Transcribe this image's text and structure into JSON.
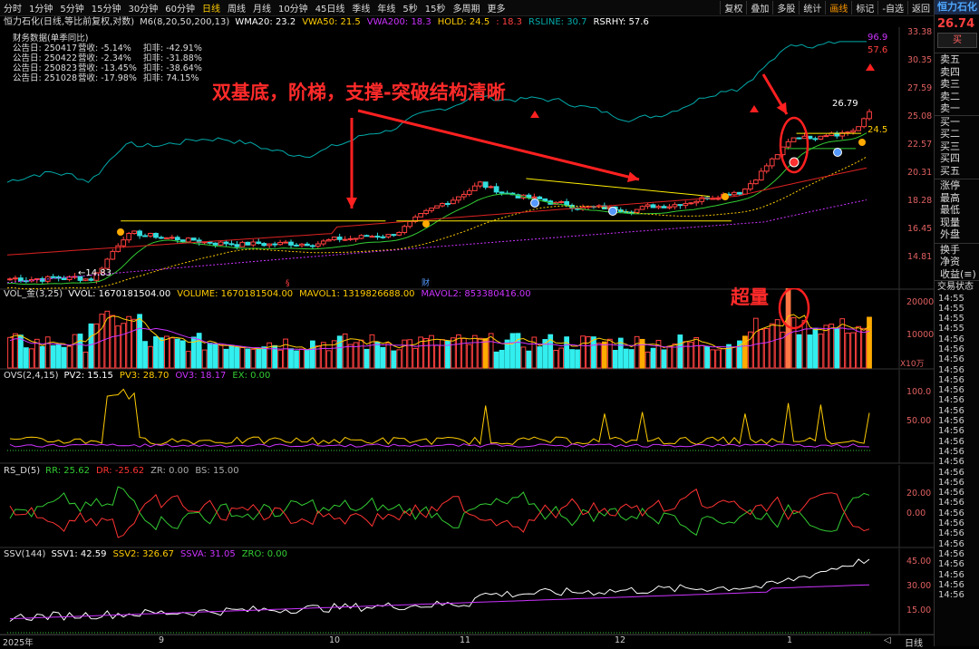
{
  "toolbar": {
    "left": [
      "分时",
      "1分钟",
      "5分钟",
      "15分钟",
      "30分钟",
      "60分钟",
      "日线",
      "周线",
      "月线",
      "10分钟",
      "45日线",
      "季线",
      "年线",
      "5秒",
      "15秒",
      "多周期",
      "更多"
    ],
    "active": "日线",
    "right": [
      "复权",
      "叠加",
      "多股",
      "统计",
      "画线",
      "标记",
      "-自选",
      "返回"
    ],
    "right_active": "画线"
  },
  "main_indicator": {
    "name": "恒力石化(日线,等比前复权,对数)",
    "ma_label": "M6(8,20,50,200,13)",
    "values": [
      {
        "label": "WMA20: 23.2",
        "color": "#ffffff"
      },
      {
        "label": "VWA50: 21.5",
        "color": "#ffcc00"
      },
      {
        "label": "VWA200: 18.3",
        "color": "#cc33ff"
      },
      {
        "label": "HOLD: 24.5",
        "color": "#ffcc00"
      },
      {
        "label": ": 18.3",
        "color": "#ff4040"
      },
      {
        "label": "RSLINE: 30.7",
        "color": "#00aaaa"
      },
      {
        "label": "RSRHY: 57.6",
        "color": "#ffffff"
      }
    ]
  },
  "financial": {
    "title": "财务数据(单季同比)",
    "rows": [
      {
        "date": "公告日: 250417",
        "rev": "营收:  -5.14%",
        "profit": "扣非:  -42.91%"
      },
      {
        "date": "公告日: 250422",
        "rev": "营收:  -2.34%",
        "profit": "扣非:  -31.88%"
      },
      {
        "date": "公告日: 250823",
        "rev": "营收: -13.45%",
        "profit": "扣非:  -38.64%"
      },
      {
        "date": "公告日: 251028",
        "rev": "营收: -17.98%",
        "profit": "扣非:  74.15%"
      }
    ]
  },
  "annotations": {
    "main_text": "双基底，阶梯，支撑-突破结构清晰",
    "volume_text": "超量",
    "price_marks": {
      "last": "26.79",
      "hold": "24.5",
      "low": "14.83",
      "top1": "96.9",
      "top2": "57.6"
    }
  },
  "price_axis": [
    "33.38",
    "30.35",
    "27.59",
    "25.08",
    "22.57",
    "20.31",
    "18.28",
    "16.45",
    "14.81"
  ],
  "volume_panel": {
    "title": "VOL_金(3,25)",
    "values": [
      {
        "label": "VVOL: 1670181504.00",
        "color": "#ffffff"
      },
      {
        "label": "VOLUME: 1670181504.00",
        "color": "#ffcc00"
      },
      {
        "label": "MAVOL1: 1319826688.00",
        "color": "#ffcc00"
      },
      {
        "label": "MAVOL2: 853380416.00",
        "color": "#cc33ff"
      }
    ],
    "axis": [
      "20000",
      "10000"
    ],
    "unit": "X10万"
  },
  "ovs_panel": {
    "title": "OVS(2,4,15)",
    "values": [
      {
        "label": "PV2: 15.15",
        "color": "#ffffff"
      },
      {
        "label": "PV3: 28.70",
        "color": "#ffcc00"
      },
      {
        "label": "OV3: 18.17",
        "color": "#cc33ff"
      },
      {
        "label": "EX: 0.00",
        "color": "#33cc33"
      }
    ],
    "axis": [
      "100.0",
      "50.00"
    ]
  },
  "rsd_panel": {
    "title": "RS_D(5)",
    "values": [
      {
        "label": "RR: 25.62",
        "color": "#33cc33"
      },
      {
        "label": "DR: -25.62",
        "color": "#ff3333"
      },
      {
        "label": "ZR: 0.00",
        "color": "#aaaaaa"
      },
      {
        "label": "BS: 15.00",
        "color": "#aaaaaa"
      }
    ],
    "axis": [
      "20.00",
      "0.00"
    ]
  },
  "ssv_panel": {
    "title": "SSV(144)",
    "values": [
      {
        "label": "SSV1: 42.59",
        "color": "#ffffff"
      },
      {
        "label": "SSV2: 326.67",
        "color": "#ffcc00"
      },
      {
        "label": "SSVA: 31.05",
        "color": "#cc33ff"
      },
      {
        "label": "ZRO: 0.00",
        "color": "#33cc33"
      }
    ],
    "axis": [
      "45.00",
      "30.00",
      "15.00"
    ]
  },
  "date_axis": [
    "2025年",
    "9",
    "10",
    "11",
    "12",
    "1"
  ],
  "date_marks": {
    "mark1": "§",
    "mark2": "财"
  },
  "bottom": {
    "period": "日线"
  },
  "right_panel": {
    "stock_name": "恒力石化",
    "price": "26.74",
    "buy_btn": "买",
    "sells": [
      "卖五",
      "卖四",
      "卖三",
      "卖二",
      "卖一"
    ],
    "buys": [
      "买一",
      "买二",
      "买三",
      "买四",
      "买五"
    ],
    "stats": [
      "涨停",
      "最高",
      "最低",
      "现量",
      "外盘"
    ],
    "stats2": [
      "换手",
      "净资",
      "收益(≡)"
    ],
    "trade_title": "交易状态",
    "times": [
      "14:55",
      "14:55",
      "14:55",
      "14:55",
      "14:56",
      "14:56",
      "14:56",
      "14:56",
      "14:56",
      "14:56",
      "14:56",
      "14:56",
      "14:56",
      "14:56",
      "14:56",
      "14:56",
      "14:56",
      "14:56",
      "14:56",
      "14:56",
      "14:56",
      "14:56",
      "14:56",
      "14:56",
      "14:56",
      "14:56",
      "14:56",
      "14:56",
      "14:56",
      "14:56"
    ]
  }
}
